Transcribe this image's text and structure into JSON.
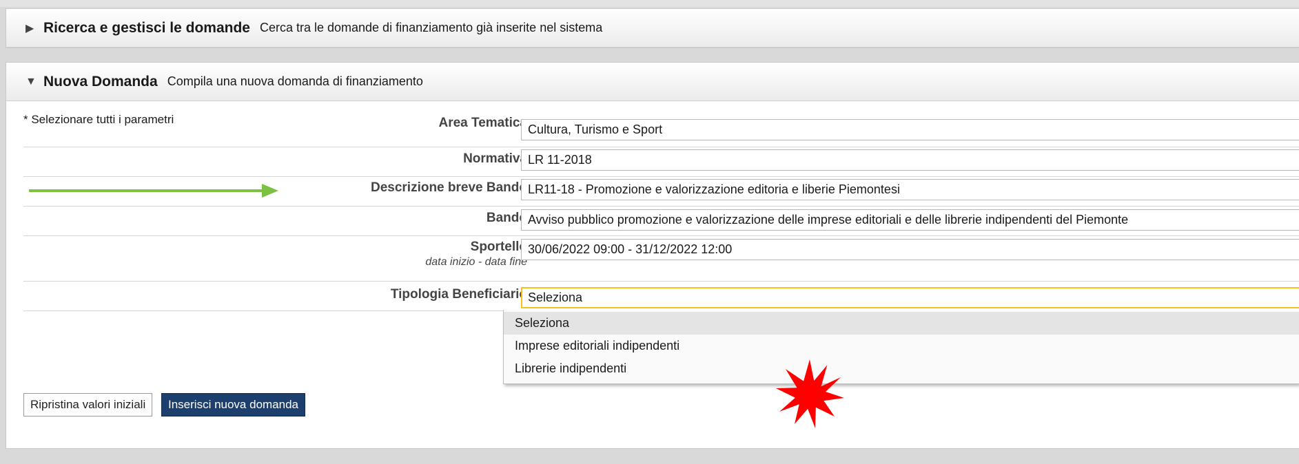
{
  "search_panel": {
    "title": "Ricerca e gestisci le domande",
    "description": "Cerca tra le domande di finanziamento già inserite nel sistema",
    "toggle_icon": "triangle-right-icon"
  },
  "new_panel": {
    "title": "Nuova Domanda",
    "description": "Compila una nuova domanda di finanziamento",
    "toggle_icon": "triangle-down-icon"
  },
  "form": {
    "required_note": "* Selezionare tutti i parametri",
    "area_tematica": {
      "label": "Area Tematica",
      "value": "Cultura, Turismo e Sport"
    },
    "normativa": {
      "label": "Normativa",
      "value": "LR 11-2018"
    },
    "descrizione_breve_bando": {
      "label": "Descrizione breve Bando",
      "value": "LR11-18 - Promozione e valorizzazione editoria e liberie Piemontesi"
    },
    "bando": {
      "label": "Bando",
      "value": "Avviso pubblico promozione e valorizzazione delle imprese editoriali e delle librerie indipendenti del Piemonte"
    },
    "sportello": {
      "label": "Sportello",
      "sublabel": "data inizio - data fine",
      "value": "30/06/2022 09:00 - 31/12/2022 12:00"
    },
    "tipologia_beneficiario": {
      "label": "Tipologia Beneficiario",
      "value": "Seleziona",
      "options": [
        "Seleziona",
        "Imprese editoriali indipendenti",
        "Librerie indipendenti"
      ]
    }
  },
  "buttons": {
    "reset_label": "Ripristina valori iniziali",
    "insert_label": "Inserisci nuova domanda"
  },
  "annotations": {
    "arrow_color": "#7cc142",
    "starburst_color": "#ff0000"
  },
  "colors": {
    "primary_button": "#1d3f6e",
    "focus_border": "#f0c419"
  }
}
